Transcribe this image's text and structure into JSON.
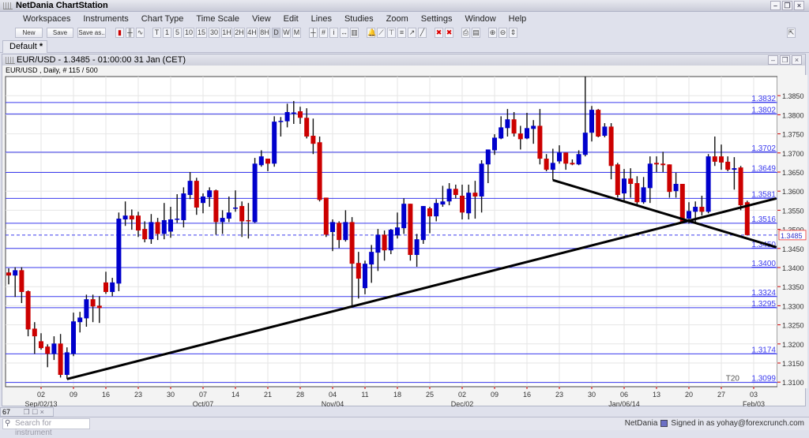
{
  "app": {
    "title": "NetDania ChartStation"
  },
  "menu": [
    "Workspaces",
    "Instruments",
    "Chart Type",
    "Time Scale",
    "View",
    "Edit",
    "Lines",
    "Studies",
    "Zoom",
    "Settings",
    "Window",
    "Help"
  ],
  "toolbar": {
    "new_label": "New",
    "save_label": "Save",
    "saveas_label": "Save as..",
    "chart_types": [
      "candlestick-icon",
      "bar-ohlc-icon",
      "line-chart-icon"
    ],
    "timeframes": [
      "T",
      "1",
      "5",
      "10",
      "15",
      "30",
      "1H",
      "2H",
      "4H",
      "8H",
      "D",
      "W",
      "M"
    ],
    "selected_timeframe": "D",
    "tools": [
      "crosshair-icon",
      "grid-icon",
      "info-icon",
      "scroll-icon",
      "volume-icon",
      "alert-bell-icon",
      "trendline-icon",
      "fibonacci-icon",
      "channel-icon",
      "arrow-icon",
      "line-tool-icon",
      "delete-icon",
      "delete-all-icon",
      "print-icon",
      "print-preview-icon",
      "zoom-in-icon",
      "zoom-out-icon",
      "fit-icon"
    ]
  },
  "tab": {
    "label": "Default",
    "modified_mark": "*"
  },
  "chart_window": {
    "title": "EUR/USD - 1.3485 - 01:00:00  31 Jan (CET)",
    "info": "EUR/USD , Daily, # 115 / 500"
  },
  "chart_data": {
    "type": "candlestick",
    "instrument": "EUR/USD",
    "interval": "Daily",
    "ylim": [
      1.3088,
      1.39
    ],
    "yticks": [
      "1.3850",
      "1.3800",
      "1.3750",
      "1.3700",
      "1.3650",
      "1.3600",
      "1.3550",
      "1.3500",
      "1.3450",
      "1.3400",
      "1.3350",
      "1.3300",
      "1.3250",
      "1.3200",
      "1.3150",
      "1.3100"
    ],
    "xticks": [
      {
        "i": 5,
        "label": "02"
      },
      {
        "i": 10,
        "label": "09"
      },
      {
        "i": 15,
        "label": "16"
      },
      {
        "i": 20,
        "label": "23"
      },
      {
        "i": 25,
        "label": "30"
      },
      {
        "i": 30,
        "label": "07"
      },
      {
        "i": 35,
        "label": "14"
      },
      {
        "i": 40,
        "label": "21"
      },
      {
        "i": 45,
        "label": "28"
      },
      {
        "i": 50,
        "label": "04"
      },
      {
        "i": 55,
        "label": "11"
      },
      {
        "i": 60,
        "label": "18"
      },
      {
        "i": 65,
        "label": "25"
      },
      {
        "i": 70,
        "label": "02"
      },
      {
        "i": 75,
        "label": "09"
      },
      {
        "i": 80,
        "label": "16"
      },
      {
        "i": 85,
        "label": "23"
      },
      {
        "i": 90,
        "label": "30"
      },
      {
        "i": 95,
        "label": "06"
      },
      {
        "i": 100,
        "label": "13"
      },
      {
        "i": 105,
        "label": "20"
      },
      {
        "i": 110,
        "label": "27"
      },
      {
        "i": 115,
        "label": "03"
      }
    ],
    "month_labels": [
      {
        "i": 5,
        "label": "Sep/02/13"
      },
      {
        "i": 30,
        "label": "Oct/07"
      },
      {
        "i": 50,
        "label": "Nov/04"
      },
      {
        "i": 70,
        "label": "Dec/02"
      },
      {
        "i": 95,
        "label": "Jan/06/14"
      },
      {
        "i": 115,
        "label": "Feb/03"
      }
    ],
    "current_price": "1.3485",
    "up_color": "#0000cc",
    "down_color": "#cc0000",
    "level_color": "#3a3aee",
    "levels": [
      "1.3832",
      "1.3802",
      "1.3702",
      "1.3649",
      "1.3581",
      "1.3516",
      "1.3450",
      "1.3400",
      "1.3324",
      "1.3295",
      "1.3174",
      "1.3099"
    ],
    "level_tag": "T20",
    "trendlines": [
      {
        "from": [
          9,
          1.3108
        ],
        "to": [
          118.5,
          1.3581
        ]
      },
      {
        "from": [
          84,
          1.3629
        ],
        "to": [
          118.5,
          1.3453
        ]
      }
    ],
    "ohlc": [
      [
        1.3387,
        1.3398,
        1.3356,
        1.3379
      ],
      [
        1.3379,
        1.3401,
        1.3323,
        1.3393
      ],
      [
        1.3393,
        1.3401,
        1.3307,
        1.3336
      ],
      [
        1.3338,
        1.334,
        1.322,
        1.3238
      ],
      [
        1.324,
        1.3257,
        1.3174,
        1.322
      ],
      [
        1.3207,
        1.3228,
        1.3185,
        1.3189
      ],
      [
        1.3193,
        1.3199,
        1.3139,
        1.3174
      ],
      [
        1.3174,
        1.322,
        1.3158,
        1.3201
      ],
      [
        1.3201,
        1.3226,
        1.3112,
        1.3119
      ],
      [
        1.3119,
        1.3191,
        1.3108,
        1.3178
      ],
      [
        1.3174,
        1.3282,
        1.3168,
        1.3259
      ],
      [
        1.3257,
        1.3284,
        1.323,
        1.3269
      ],
      [
        1.3267,
        1.3329,
        1.3245,
        1.3317
      ],
      [
        1.3317,
        1.3329,
        1.3257,
        1.3298
      ],
      [
        1.33,
        1.3325,
        1.3255,
        1.3294
      ],
      [
        1.3361,
        1.3389,
        1.3331,
        1.3336
      ],
      [
        1.3336,
        1.3373,
        1.3325,
        1.3361
      ],
      [
        1.3358,
        1.3544,
        1.3338,
        1.3528
      ],
      [
        1.3526,
        1.3573,
        1.3509,
        1.3536
      ],
      [
        1.3536,
        1.3552,
        1.3499,
        1.3526
      ],
      [
        1.3536,
        1.3546,
        1.348,
        1.3497
      ],
      [
        1.3501,
        1.3521,
        1.3466,
        1.3474
      ],
      [
        1.3474,
        1.354,
        1.3462,
        1.3519
      ],
      [
        1.3519,
        1.353,
        1.3472,
        1.3488
      ],
      [
        1.3488,
        1.3569,
        1.3474,
        1.3524
      ],
      [
        1.3494,
        1.3559,
        1.3478,
        1.3526
      ],
      [
        1.3526,
        1.3592,
        1.3517,
        1.3528
      ],
      [
        1.3524,
        1.361,
        1.3505,
        1.3594
      ],
      [
        1.359,
        1.365,
        1.3579,
        1.3627
      ],
      [
        1.3627,
        1.3635,
        1.3538,
        1.3557
      ],
      [
        1.3569,
        1.3594,
        1.3542,
        1.3586
      ],
      [
        1.3584,
        1.361,
        1.3559,
        1.3602
      ],
      [
        1.3602,
        1.3604,
        1.3486,
        1.3519
      ],
      [
        1.3519,
        1.355,
        1.3488,
        1.353
      ],
      [
        1.3528,
        1.3586,
        1.3519,
        1.3544
      ],
      [
        1.3555,
        1.3602,
        1.3546,
        1.3557
      ],
      [
        1.3561,
        1.3573,
        1.348,
        1.3521
      ],
      [
        1.3524,
        1.3569,
        1.3476,
        1.3522
      ],
      [
        1.3519,
        1.3687,
        1.3517,
        1.3672
      ],
      [
        1.3668,
        1.3707,
        1.3664,
        1.3691
      ],
      [
        1.3685,
        1.3685,
        1.3652,
        1.3672
      ],
      [
        1.3672,
        1.3796,
        1.3664,
        1.3782
      ],
      [
        1.3781,
        1.3794,
        1.3743,
        1.3784
      ],
      [
        1.3783,
        1.3829,
        1.3767,
        1.3807
      ],
      [
        1.3805,
        1.3836,
        1.3776,
        1.3806
      ],
      [
        1.3809,
        1.3821,
        1.3776,
        1.3792
      ],
      [
        1.3792,
        1.3817,
        1.3738,
        1.3743
      ],
      [
        1.3745,
        1.379,
        1.3697,
        1.3724
      ],
      [
        1.3728,
        1.3743,
        1.3573,
        1.3577
      ],
      [
        1.3583,
        1.3583,
        1.348,
        1.3486
      ],
      [
        1.3493,
        1.3526,
        1.3443,
        1.3519
      ],
      [
        1.3517,
        1.3521,
        1.3451,
        1.3472
      ],
      [
        1.3472,
        1.355,
        1.3468,
        1.3519
      ],
      [
        1.3519,
        1.3532,
        1.3296,
        1.341
      ],
      [
        1.3412,
        1.3441,
        1.3319,
        1.3371
      ],
      [
        1.3346,
        1.3418,
        1.333,
        1.341
      ],
      [
        1.3408,
        1.3459,
        1.336,
        1.3441
      ],
      [
        1.3439,
        1.3501,
        1.3391,
        1.3486
      ],
      [
        1.3486,
        1.3497,
        1.3418,
        1.3445
      ],
      [
        1.3445,
        1.3501,
        1.3435,
        1.3499
      ],
      [
        1.3484,
        1.3544,
        1.3476,
        1.3505
      ],
      [
        1.3503,
        1.3581,
        1.3488,
        1.3567
      ],
      [
        1.3567,
        1.3567,
        1.3418,
        1.3433
      ],
      [
        1.3433,
        1.3488,
        1.3402,
        1.3474
      ],
      [
        1.3472,
        1.3561,
        1.3462,
        1.3561
      ],
      [
        1.3555,
        1.3559,
        1.349,
        1.3534
      ],
      [
        1.3534,
        1.3579,
        1.3521,
        1.3569
      ],
      [
        1.3565,
        1.3614,
        1.3559,
        1.3573
      ],
      [
        1.3573,
        1.3621,
        1.3563,
        1.3606
      ],
      [
        1.3606,
        1.3617,
        1.3581,
        1.359
      ],
      [
        1.3588,
        1.3617,
        1.3526,
        1.3544
      ],
      [
        1.3542,
        1.3617,
        1.3526,
        1.3596
      ],
      [
        1.3596,
        1.3627,
        1.3528,
        1.3586
      ],
      [
        1.3586,
        1.3681,
        1.3544,
        1.3672
      ],
      [
        1.367,
        1.3709,
        1.3621,
        1.3709
      ],
      [
        1.3707,
        1.3749,
        1.3695,
        1.374
      ],
      [
        1.3738,
        1.3796,
        1.3736,
        1.3767
      ],
      [
        1.3765,
        1.3815,
        1.3743,
        1.3788
      ],
      [
        1.3788,
        1.3807,
        1.3743,
        1.3751
      ],
      [
        1.3751,
        1.3771,
        1.3709,
        1.3736
      ],
      [
        1.3738,
        1.3805,
        1.3736,
        1.3765
      ],
      [
        1.3763,
        1.3786,
        1.3724,
        1.3771
      ],
      [
        1.3771,
        1.3815,
        1.367,
        1.3685
      ],
      [
        1.3685,
        1.3697,
        1.3652,
        1.3656
      ],
      [
        1.3656,
        1.3711,
        1.3629,
        1.3674
      ],
      [
        1.3678,
        1.372,
        1.3672,
        1.3701
      ],
      [
        1.3701,
        1.3701,
        1.3656,
        1.3672
      ],
      [
        1.3674,
        1.3683,
        1.3668,
        1.367
      ],
      [
        1.367,
        1.3707,
        1.3668,
        1.3697
      ],
      [
        1.3695,
        1.39,
        1.3691,
        1.3753
      ],
      [
        1.3753,
        1.3823,
        1.373,
        1.3813
      ],
      [
        1.3813,
        1.3815,
        1.3741,
        1.3743
      ],
      [
        1.3745,
        1.3778,
        1.3741,
        1.3769
      ],
      [
        1.3769,
        1.3778,
        1.3631,
        1.3666
      ],
      [
        1.367,
        1.3674,
        1.3583,
        1.359
      ],
      [
        1.3594,
        1.3658,
        1.3571,
        1.3633
      ],
      [
        1.3633,
        1.366,
        1.3583,
        1.3619
      ],
      [
        1.3621,
        1.3639,
        1.3563,
        1.3571
      ],
      [
        1.3571,
        1.3637,
        1.3567,
        1.361
      ],
      [
        1.3608,
        1.3691,
        1.3569,
        1.3672
      ],
      [
        1.3674,
        1.3691,
        1.365,
        1.367
      ],
      [
        1.3672,
        1.3703,
        1.365,
        1.3668
      ],
      [
        1.367,
        1.367,
        1.3583,
        1.3598
      ],
      [
        1.36,
        1.3648,
        1.3583,
        1.3619
      ],
      [
        1.3619,
        1.3619,
        1.3515,
        1.3517
      ],
      [
        1.3528,
        1.3571,
        1.3515,
        1.3548
      ],
      [
        1.3546,
        1.3573,
        1.3517,
        1.3559
      ],
      [
        1.3559,
        1.3588,
        1.3536,
        1.3546
      ],
      [
        1.3546,
        1.3697,
        1.3542,
        1.3691
      ],
      [
        1.3691,
        1.3743,
        1.3666,
        1.3677
      ],
      [
        1.3691,
        1.3722,
        1.3656,
        1.3675
      ],
      [
        1.3677,
        1.3691,
        1.3652,
        1.3656
      ],
      [
        1.3656,
        1.3689,
        1.3604,
        1.366
      ],
      [
        1.3662,
        1.3666,
        1.355,
        1.3563
      ],
      [
        1.3571,
        1.3575,
        1.3484,
        1.3485
      ]
    ]
  },
  "footer": {
    "panel_number": "67",
    "search_placeholder": "Search for instrument",
    "brand": "NetDania",
    "signed_in": "Signed in as yohay@forexcrunch.com"
  }
}
